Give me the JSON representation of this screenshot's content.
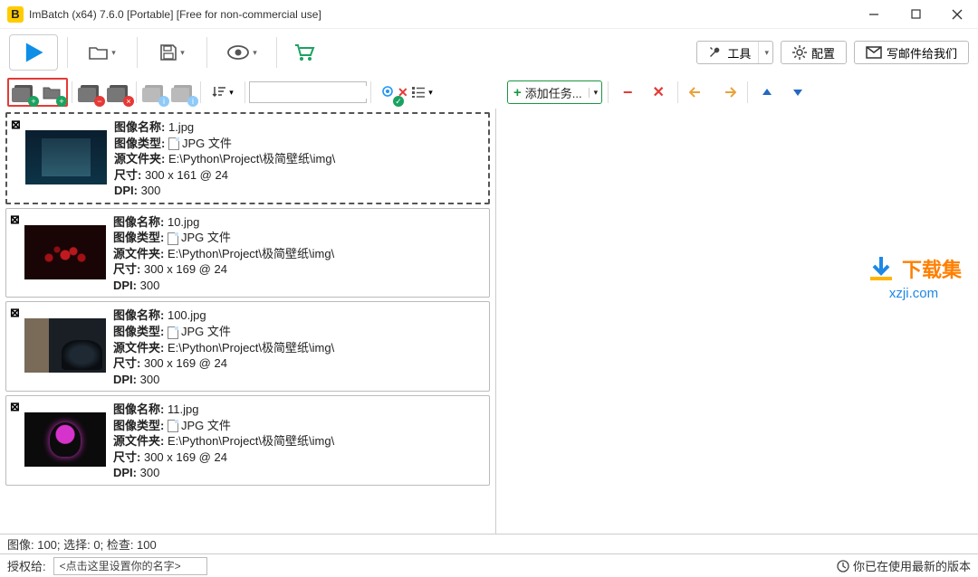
{
  "window": {
    "title": "ImBatch (x64) 7.6.0 [Portable] [Free for non-commercial use]"
  },
  "toolbar": {
    "tools": "工具",
    "config": "配置",
    "email_us": "写邮件给我们"
  },
  "subtoolbar": {
    "add_task": "添加任务..."
  },
  "labels": {
    "name": "图像名称:",
    "type": "图像类型:",
    "folder": "源文件夹:",
    "size": "尺寸:",
    "dpi": "DPI:"
  },
  "images": [
    {
      "name": "1.jpg",
      "type": "JPG 文件",
      "folder": "E:\\Python\\Project\\极简壁纸\\img\\",
      "size": "300 x 161 @ 24",
      "dpi": "300",
      "selected": true,
      "thumb": "th1"
    },
    {
      "name": "10.jpg",
      "type": "JPG 文件",
      "folder": "E:\\Python\\Project\\极简壁纸\\img\\",
      "size": "300 x 169 @ 24",
      "dpi": "300",
      "selected": false,
      "thumb": "th2"
    },
    {
      "name": "100.jpg",
      "type": "JPG 文件",
      "folder": "E:\\Python\\Project\\极简壁纸\\img\\",
      "size": "300 x 169 @ 24",
      "dpi": "300",
      "selected": false,
      "thumb": "th3"
    },
    {
      "name": "11.jpg",
      "type": "JPG 文件",
      "folder": "E:\\Python\\Project\\极简壁纸\\img\\",
      "size": "300 x 169 @ 24",
      "dpi": "300",
      "selected": false,
      "thumb": "th4"
    }
  ],
  "status": {
    "image_count_line": "图像: 100; 选择: 0; 检查: 100",
    "licensed_to": "授权给:",
    "license_placeholder": "<点击这里设置你的名字>",
    "version_msg": "你已在使用最新的版本"
  },
  "watermark": {
    "line1": "下载集",
    "line2": "xzji.com"
  }
}
